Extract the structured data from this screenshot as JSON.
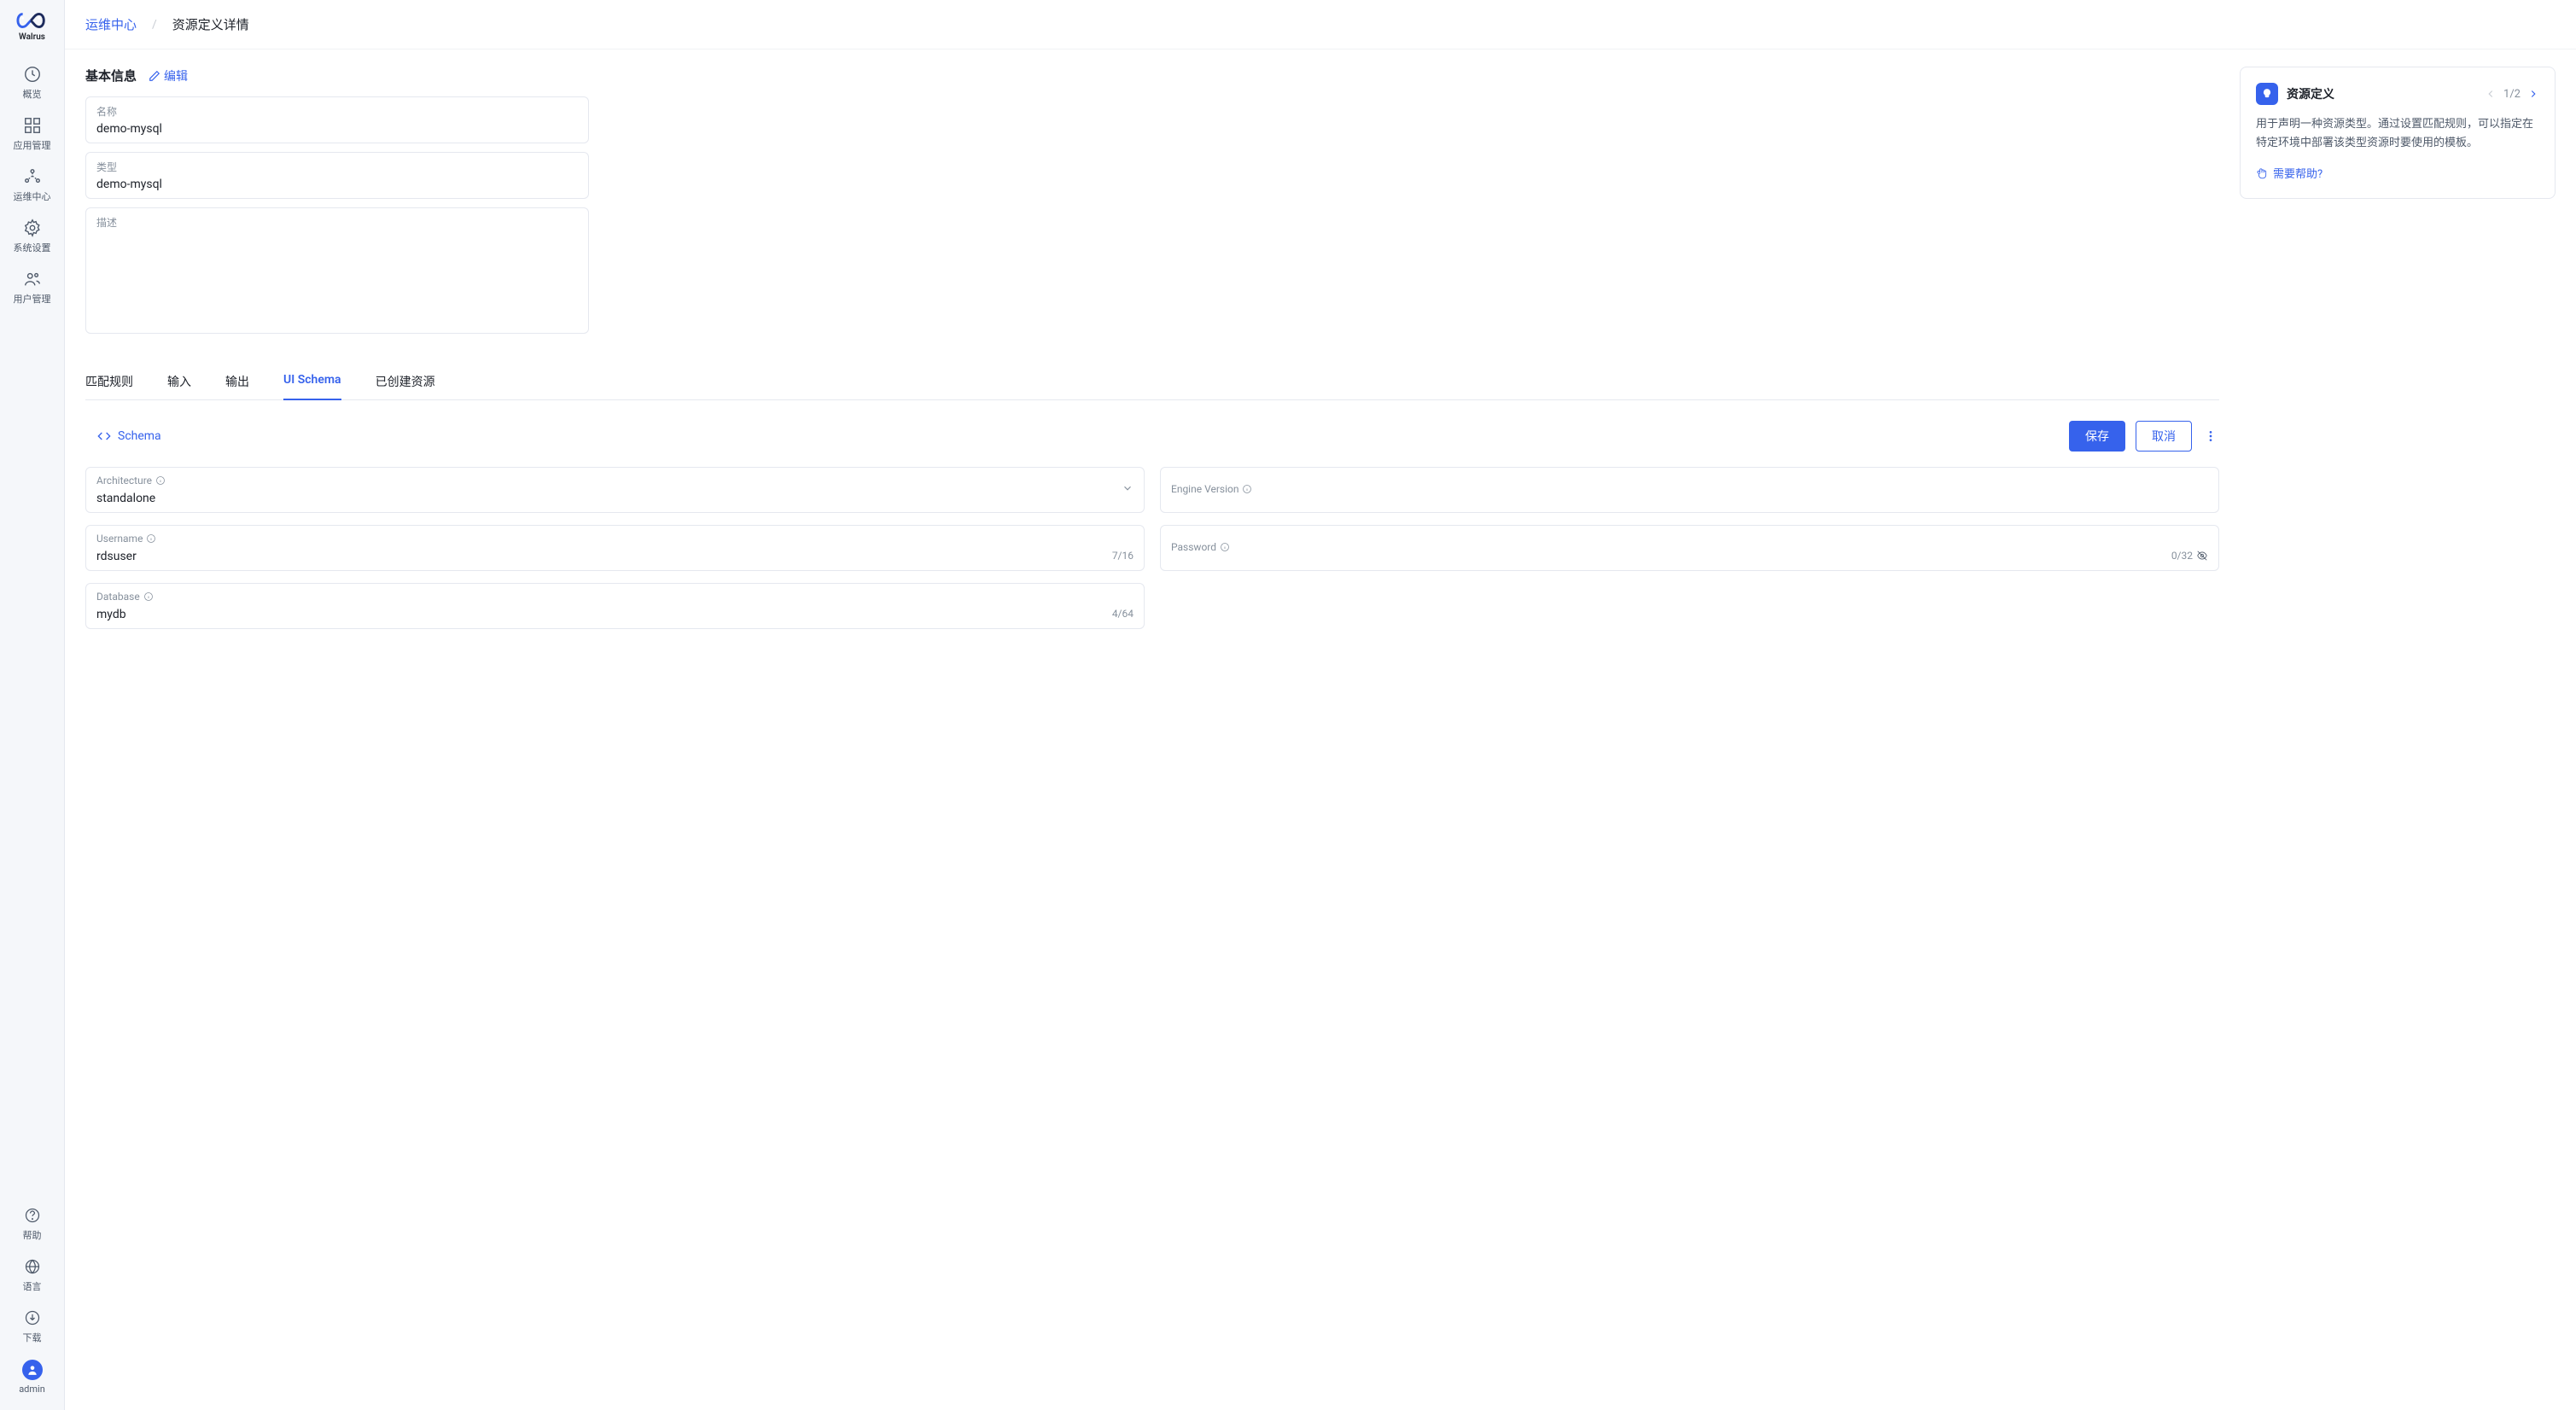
{
  "brand": "Walrus",
  "sidebar": {
    "items": [
      {
        "label": "概览"
      },
      {
        "label": "应用管理"
      },
      {
        "label": "运维中心"
      },
      {
        "label": "系统设置"
      },
      {
        "label": "用户管理"
      }
    ],
    "bottom": [
      {
        "label": "帮助"
      },
      {
        "label": "语言"
      },
      {
        "label": "下载"
      }
    ],
    "user": "admin"
  },
  "breadcrumb": {
    "link": "运维中心",
    "sep": "/",
    "current": "资源定义详情"
  },
  "basic": {
    "title": "基本信息",
    "edit": "编辑",
    "name_label": "名称",
    "name_value": "demo-mysql",
    "type_label": "类型",
    "type_value": "demo-mysql",
    "desc_label": "描述",
    "desc_value": ""
  },
  "tabs": [
    {
      "label": "匹配规则"
    },
    {
      "label": "输入"
    },
    {
      "label": "输出"
    },
    {
      "label": "UI Schema"
    },
    {
      "label": "已创建资源"
    }
  ],
  "schema": {
    "label": "Schema",
    "save": "保存",
    "cancel": "取消",
    "fields": {
      "architecture": {
        "label": "Architecture",
        "value": "standalone"
      },
      "engine_version": {
        "label": "Engine Version",
        "value": ""
      },
      "username": {
        "label": "Username",
        "value": "rdsuser",
        "counter": "7/16"
      },
      "password": {
        "label": "Password",
        "value": "",
        "counter": "0/32"
      },
      "database": {
        "label": "Database",
        "value": "mydb",
        "counter": "4/64"
      }
    }
  },
  "help": {
    "title": "资源定义",
    "pager": "1/2",
    "desc": "用于声明一种资源类型。通过设置匹配规则，可以指定在特定环境中部署该类型资源时要使用的模板。",
    "link": "需要帮助?"
  }
}
